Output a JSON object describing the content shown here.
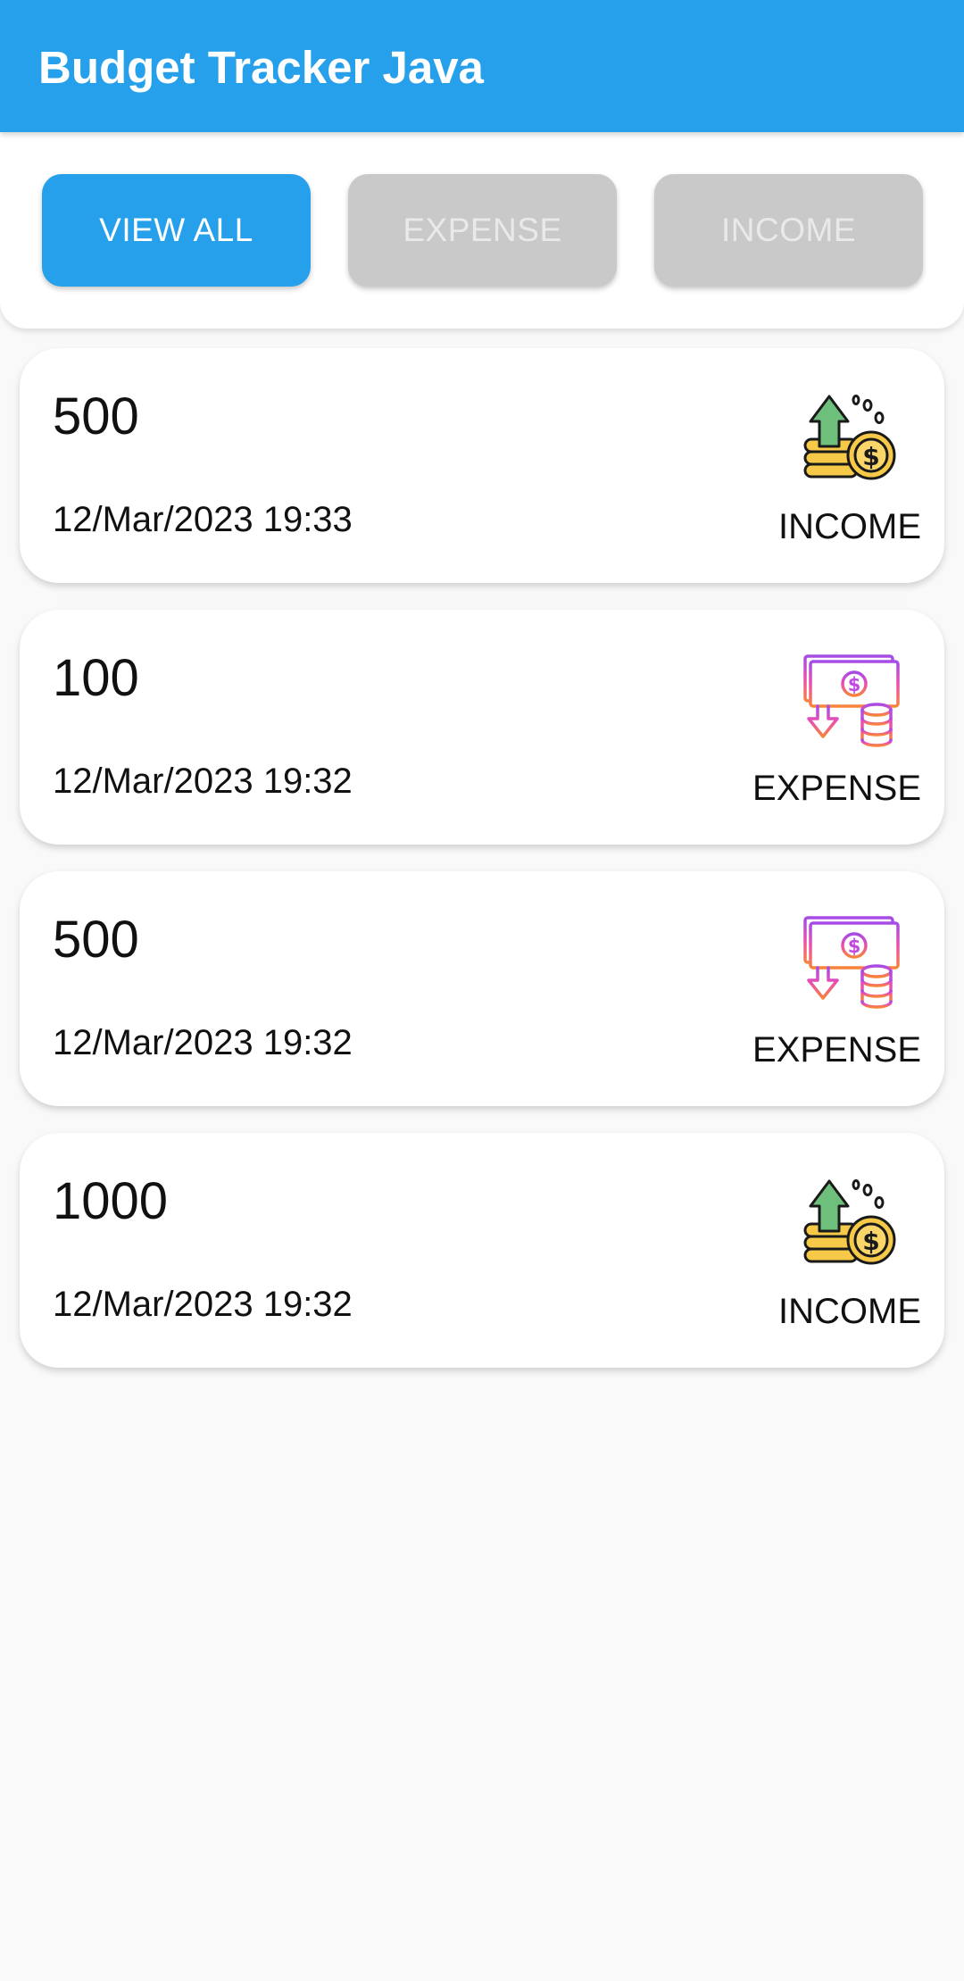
{
  "app_bar": {
    "title": "Budget Tracker Java",
    "color": "#26a0ea"
  },
  "filters": {
    "view_all": "VIEW ALL",
    "expense": "EXPENSE",
    "income": "INCOME",
    "selected": "VIEW ALL"
  },
  "transactions": [
    {
      "amount": "500",
      "date": "12/Mar/2023 19:33",
      "type": "INCOME",
      "icon": "income-coins-arrow-up-icon"
    },
    {
      "amount": "100",
      "date": "12/Mar/2023 19:32",
      "type": "EXPENSE",
      "icon": "expense-bill-arrow-down-icon"
    },
    {
      "amount": "500",
      "date": "12/Mar/2023 19:32",
      "type": "EXPENSE",
      "icon": "expense-bill-arrow-down-icon"
    },
    {
      "amount": "1000",
      "date": "12/Mar/2023 19:32",
      "type": "INCOME",
      "icon": "income-coins-arrow-up-icon"
    }
  ],
  "colors": {
    "accent": "#26a0ea",
    "inactive_button": "#c9c9c9",
    "income_arrow": "#6fbf7c",
    "coin": "#f7c948",
    "expense_bill": "#c04be0",
    "expense_arrow": "#f06a4a"
  }
}
